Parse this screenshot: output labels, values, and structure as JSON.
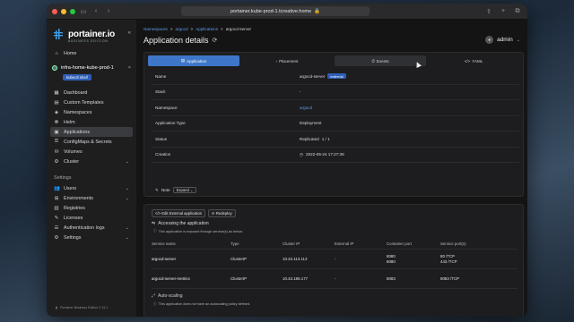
{
  "browser": {
    "url": "portainer.kube-prod-1.tcreative.home"
  },
  "sidebar": {
    "logo": "portainer.io",
    "logo_sub": "BUSINESS EDITION",
    "home": "Home",
    "environment": "infra-home-kube-prod-1",
    "kubectl": "kubectl shell",
    "items": [
      {
        "label": "Dashboard",
        "icon": "dashboard-icon"
      },
      {
        "label": "Custom Templates",
        "icon": "template-icon"
      },
      {
        "label": "Namespaces",
        "icon": "namespace-icon"
      },
      {
        "label": "Helm",
        "icon": "helm-icon"
      },
      {
        "label": "Applications",
        "icon": "applications-icon"
      },
      {
        "label": "ConfigMaps & Secrets",
        "icon": "lock-icon"
      },
      {
        "label": "Volumes",
        "icon": "volume-icon"
      },
      {
        "label": "Cluster",
        "icon": "cluster-icon"
      }
    ],
    "settings_title": "Settings",
    "settings_items": [
      {
        "label": "Users"
      },
      {
        "label": "Environments"
      },
      {
        "label": "Registries"
      },
      {
        "label": "Licenses"
      },
      {
        "label": "Authentication logs"
      },
      {
        "label": "Settings"
      }
    ],
    "footer": "Portainer Business Edition 2.13.1"
  },
  "header": {
    "breadcrumb": [
      "Namespaces",
      "argocd",
      "Applications",
      "argocd-server"
    ],
    "title": "Application details",
    "user": "admin"
  },
  "tabs": [
    "Application",
    "Placement",
    "Events",
    "YAML"
  ],
  "details": {
    "name_label": "Name",
    "name": "argocd-server",
    "name_badge": "external",
    "stack_label": "Stack",
    "stack": "-",
    "namespace_label": "Namespace",
    "namespace": "argocd",
    "type_label": "Application Type",
    "type": "Deployment",
    "status_label": "Status",
    "status": "Replicated",
    "replicas": "1 / 1",
    "creation_label": "Creation",
    "creation": "2022-05-24 17:27:38",
    "note_label": "Note",
    "expand": "Expand"
  },
  "services": {
    "edit_btn": "Edit External application",
    "redeploy_btn": "Redeploy",
    "title": "Accessing the application",
    "info": "This application is exposed through service(s) as below:",
    "columns": [
      "Service name",
      "Type",
      "Cluster IP",
      "External IP",
      "Container port",
      "Service port(s)"
    ],
    "rows": [
      {
        "name": "argocd-server",
        "type": "ClusterIP",
        "cluster_ip": "10.43.113.113",
        "external_ip": "-",
        "container_port_1": "8080",
        "container_port_2": "8080",
        "service_port_1": "80 /TCP",
        "service_port_2": "443 /TCP"
      },
      {
        "name": "argocd-server-metrics",
        "type": "ClusterIP",
        "cluster_ip": "10.43.186.177",
        "external_ip": "-",
        "container_port_1": "8083",
        "container_port_2": "",
        "service_port_1": "8083 /TCP",
        "service_port_2": ""
      }
    ],
    "autoscaling_title": "Auto-scaling",
    "autoscaling_info": "This application does not have an autoscaling policy defined."
  }
}
